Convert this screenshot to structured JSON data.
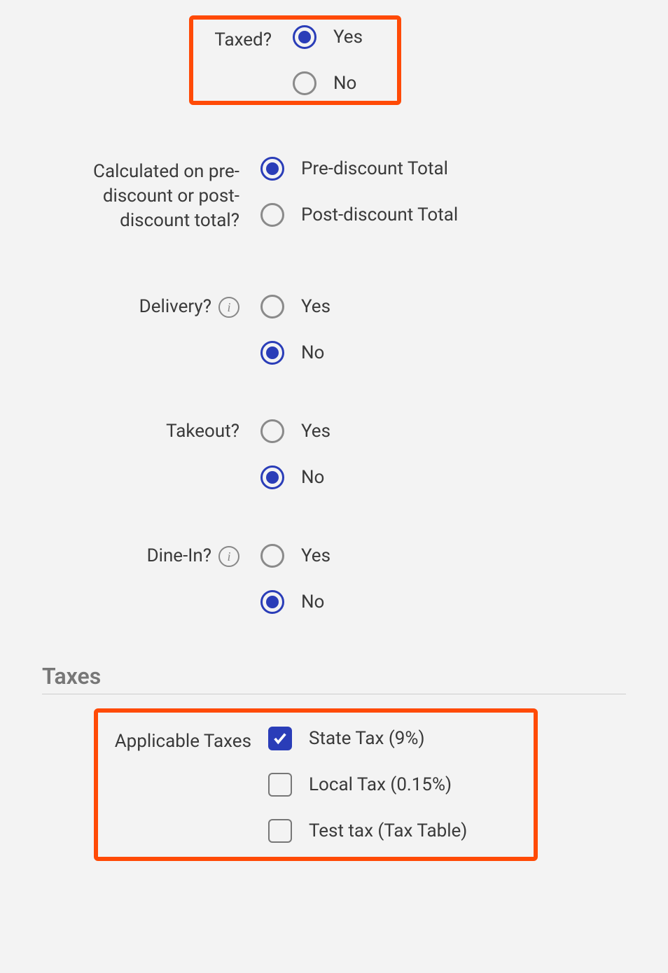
{
  "taxed": {
    "label": "Taxed?",
    "yes": "Yes",
    "no": "No"
  },
  "calc": {
    "label": "Calculated on pre-discount or post-discount total?",
    "pre": "Pre-discount Total",
    "post": "Post-discount Total"
  },
  "delivery": {
    "label": "Delivery?",
    "yes": "Yes",
    "no": "No"
  },
  "takeout": {
    "label": "Takeout?",
    "yes": "Yes",
    "no": "No"
  },
  "dinein": {
    "label": "Dine-In?",
    "yes": "Yes",
    "no": "No"
  },
  "taxes_section_title": "Taxes",
  "applicable": {
    "label": "Applicable Taxes",
    "state": "State Tax (9%)",
    "local": "Local Tax (0.15%)",
    "test": "Test tax (Tax Table)"
  }
}
